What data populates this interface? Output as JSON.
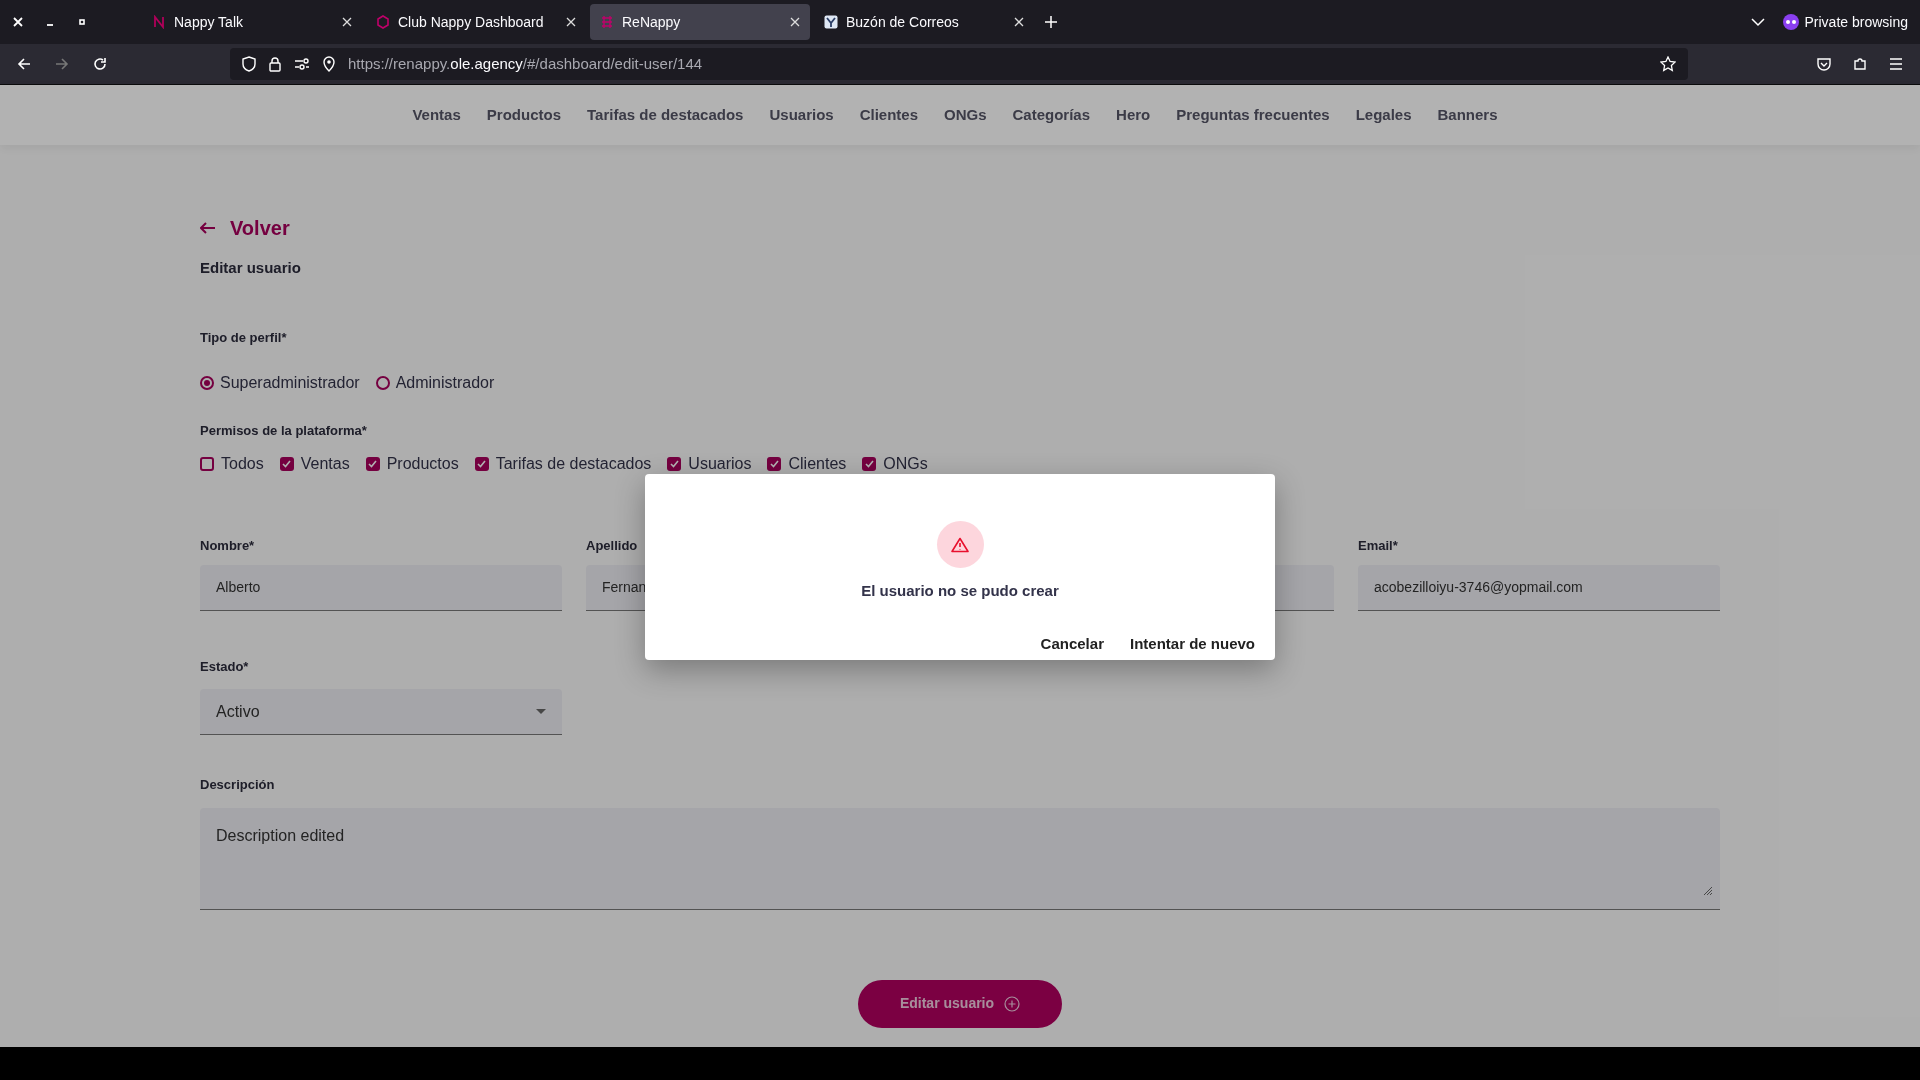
{
  "browser": {
    "tabs": [
      {
        "title": "Nappy Talk",
        "selected": false
      },
      {
        "title": "Club Nappy Dashboard",
        "selected": false
      },
      {
        "title": "ReNappy",
        "selected": true
      },
      {
        "title": "Buzón de Correos",
        "selected": false
      }
    ],
    "private_label": "Private browsing",
    "url": {
      "prefix": "https://renappy.",
      "domain": "ole.agency",
      "path": "/#/dashboard/edit-user/144"
    }
  },
  "nav": [
    "Ventas",
    "Productos",
    "Tarifas de destacados",
    "Usuarios",
    "Clientes",
    "ONGs",
    "Categorías",
    "Hero",
    "Preguntas frecuentes",
    "Legales",
    "Banners"
  ],
  "back_link": "Volver",
  "heading": "Editar usuario",
  "profile": {
    "label": "Tipo de perfil*",
    "options": [
      {
        "label": "Superadministrador",
        "selected": true
      },
      {
        "label": "Administrador",
        "selected": false
      }
    ]
  },
  "permissions": {
    "label": "Permisos de la plataforma*",
    "options": [
      {
        "label": "Todos",
        "checked": false
      },
      {
        "label": "Ventas",
        "checked": true
      },
      {
        "label": "Productos",
        "checked": true
      },
      {
        "label": "Tarifas de destacados",
        "checked": true
      },
      {
        "label": "Usuarios",
        "checked": true
      },
      {
        "label": "Clientes",
        "checked": true
      },
      {
        "label": "ONGs",
        "checked": true
      }
    ]
  },
  "fields": [
    {
      "kind": "text",
      "label": "Nombre*",
      "value": "Alberto"
    },
    {
      "kind": "text",
      "label": "Apellido",
      "value": "Fernan"
    },
    {
      "kind": "text"
    },
    {
      "kind": "text",
      "label": "Email*",
      "value": "acobezilloiyu-3746@yopmail.com"
    }
  ],
  "status": {
    "label": "Estado*",
    "value": "Activo"
  },
  "description": {
    "label": "Descripción",
    "value": "Description edited"
  },
  "submit": "Editar usuario",
  "dialog": {
    "message": "El usuario no se pudo crear",
    "buttons": [
      "Cancelar",
      "Intentar de nuevo"
    ]
  }
}
